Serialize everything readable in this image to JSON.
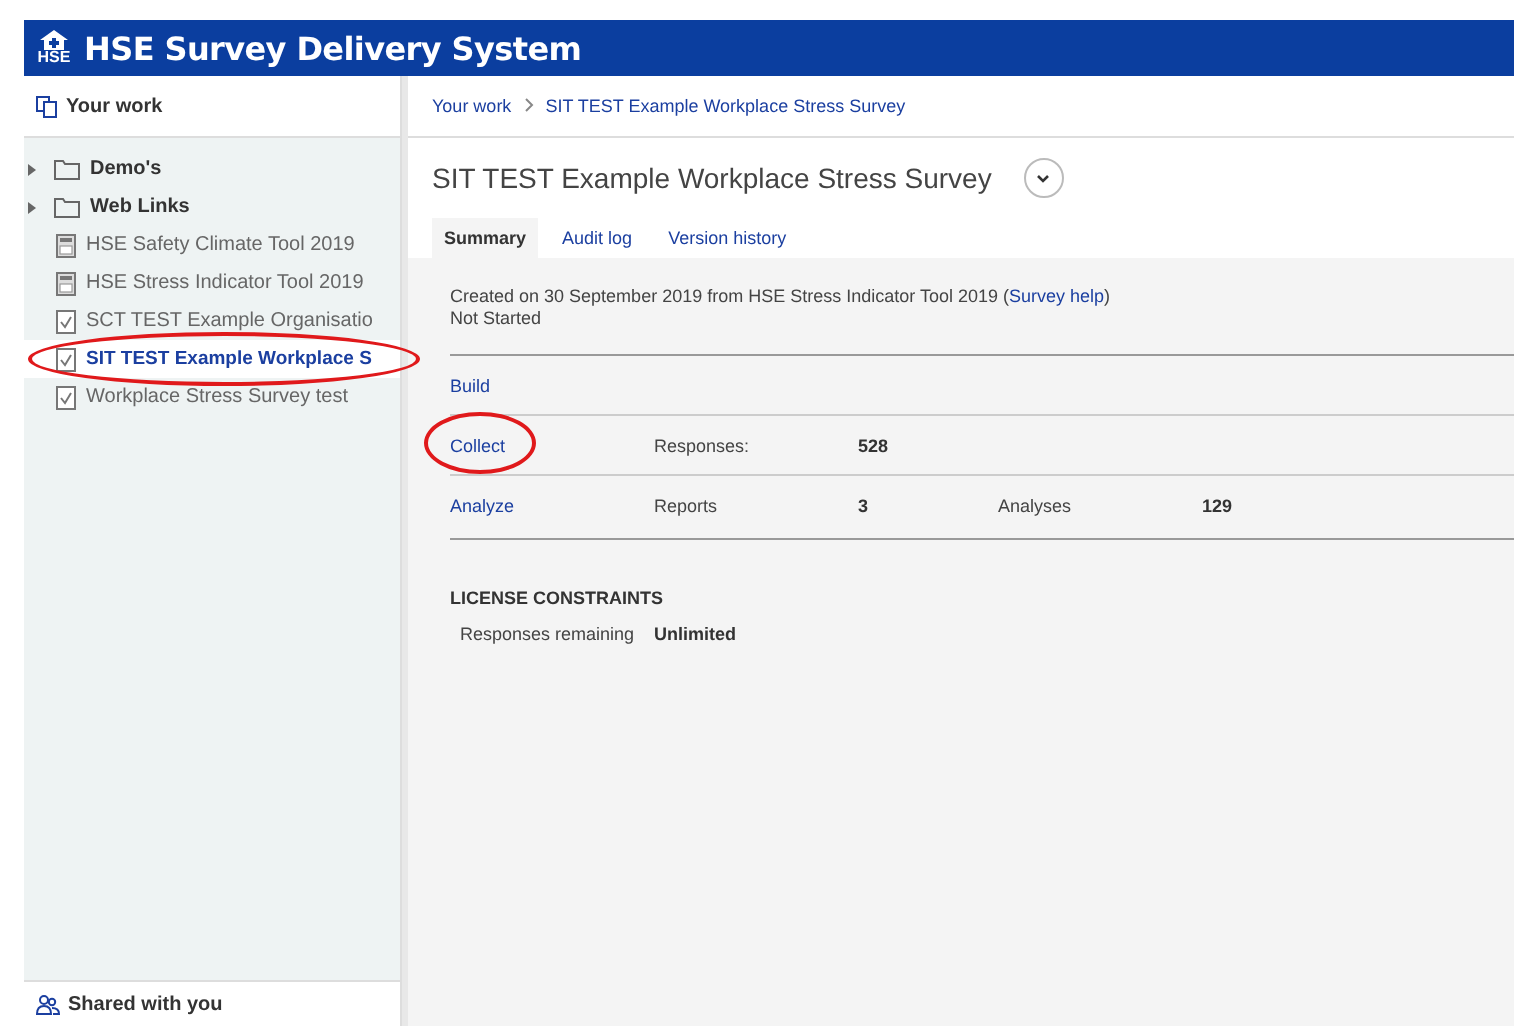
{
  "header": {
    "title": "HSE Survey Delivery System",
    "logo_text": "HSE"
  },
  "sidebar": {
    "heading": "Your work",
    "items": [
      {
        "kind": "folder",
        "label": "Demo's",
        "selected": false,
        "circled": false
      },
      {
        "kind": "folder",
        "label": "Web Links",
        "selected": false,
        "circled": false
      },
      {
        "kind": "template",
        "label": "HSE Safety Climate Tool 2019",
        "selected": false,
        "circled": false
      },
      {
        "kind": "template",
        "label": "HSE Stress Indicator Tool 2019",
        "selected": false,
        "circled": false
      },
      {
        "kind": "survey",
        "label": "SCT TEST Example Organisatio",
        "selected": false,
        "circled": false
      },
      {
        "kind": "survey",
        "label": "SIT TEST Example Workplace S",
        "selected": true,
        "circled": true
      },
      {
        "kind": "survey",
        "label": "Workplace Stress Survey test",
        "selected": false,
        "circled": false
      }
    ],
    "footer": "Shared with you"
  },
  "breadcrumb": [
    "Your work",
    "SIT TEST Example Workplace Stress Survey"
  ],
  "title": "SIT TEST Example Workplace Stress Survey",
  "tabs": [
    {
      "label": "Summary",
      "selected": true
    },
    {
      "label": "Audit log",
      "selected": false
    },
    {
      "label": "Version history",
      "selected": false
    }
  ],
  "summary": {
    "created": "Created on 30 September 2019 from HSE Stress Indicator Tool 2019 (",
    "help_link": "Survey help",
    "created_end": ")",
    "status": "Not Started"
  },
  "stages": [
    {
      "link": "Build",
      "circled": false
    },
    {
      "link": "Collect",
      "circled": true,
      "stats": [
        {
          "label": "Responses:",
          "value": "528"
        }
      ]
    },
    {
      "link": "Analyze",
      "circled": false,
      "stats": [
        {
          "label": "Reports",
          "value": "3"
        },
        {
          "label": "Analyses",
          "value": "129"
        }
      ]
    }
  ],
  "license": {
    "heading": "LICENSE CONSTRAINTS",
    "label": "Responses remaining",
    "value": "Unlimited"
  }
}
